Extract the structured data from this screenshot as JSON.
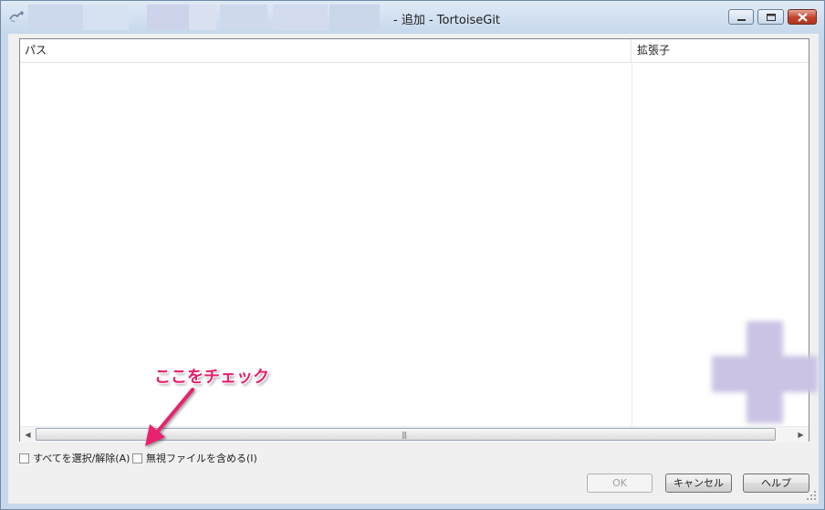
{
  "window": {
    "title": "- 追加 - TortoiseGit",
    "app_icon": "tortoisegit-icon"
  },
  "listview": {
    "columns": [
      "パス",
      "拡張子"
    ],
    "rows": []
  },
  "options": {
    "select_all_label": "すべてを選択/解除(A)",
    "include_ignored_label": "無視ファイルを含める(I)",
    "select_all_checked": false,
    "include_ignored_checked": false
  },
  "buttons": {
    "ok": "OK",
    "cancel": "キャンセル",
    "help": "ヘルプ"
  },
  "annotation": {
    "text": "ここをチェック",
    "color": "#e8206e"
  },
  "colors": {
    "titlebar": "#c6d8ec",
    "client": "#f0f0f0",
    "watermark": "#cfc8e4"
  }
}
